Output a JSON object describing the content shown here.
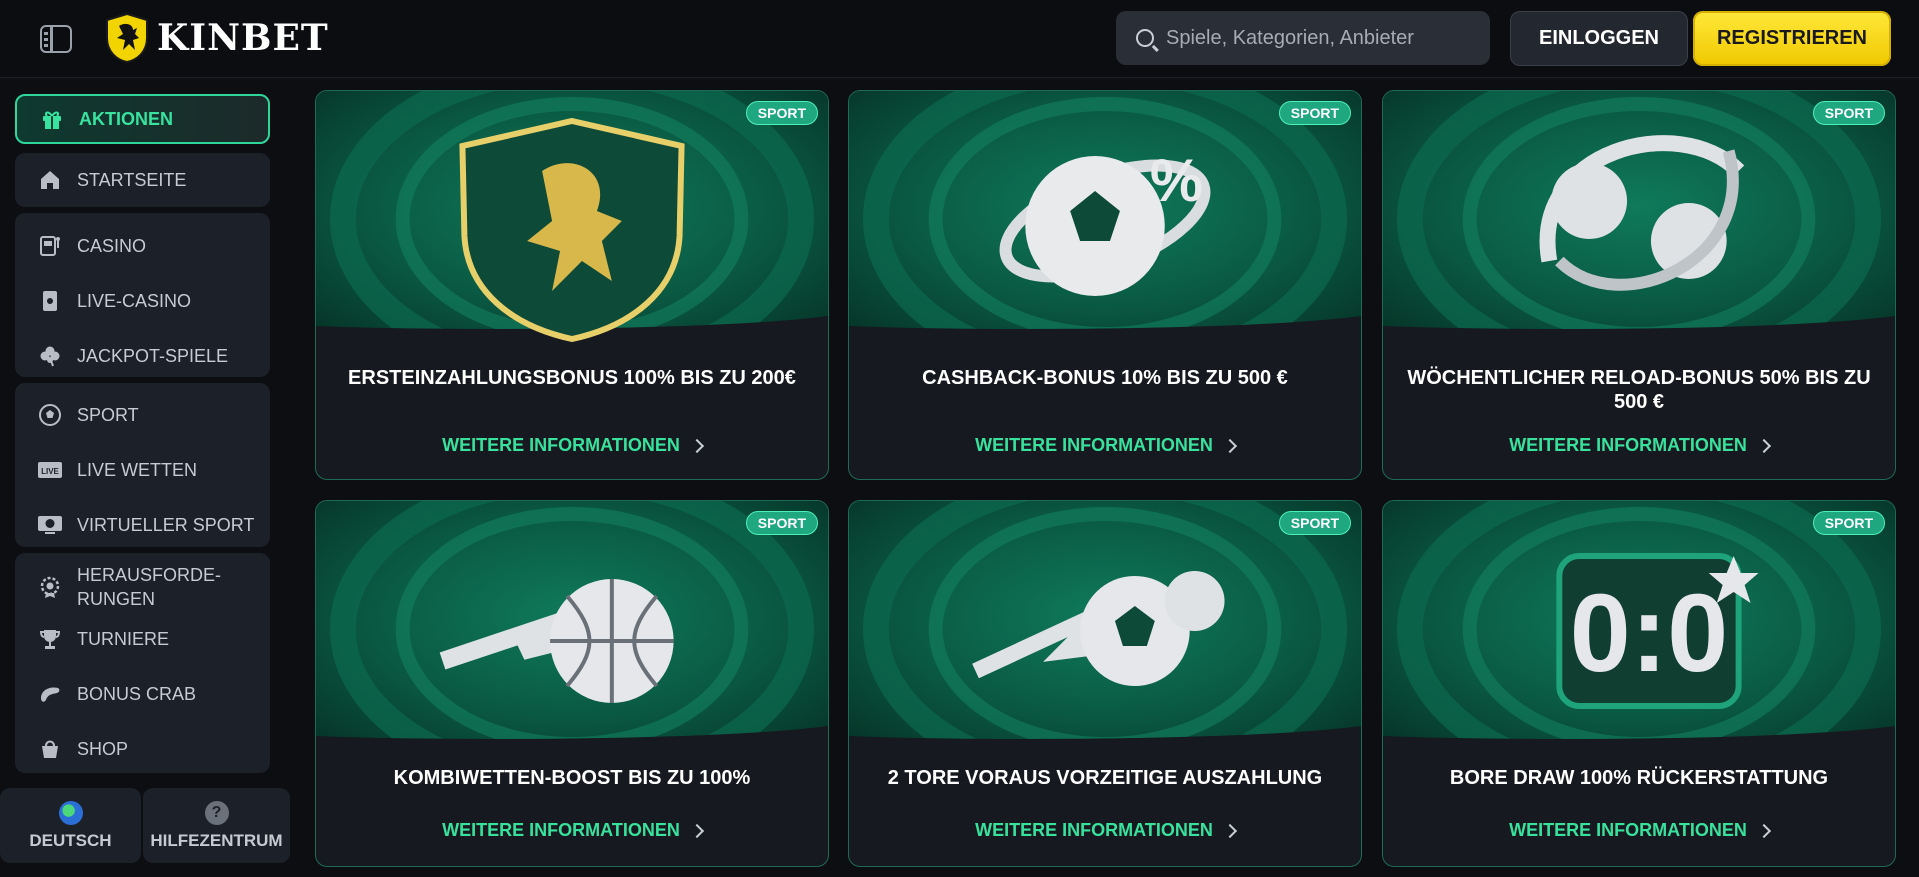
{
  "brand": {
    "name": "KINBET"
  },
  "header": {
    "search_placeholder": "Spiele, Kategorien, Anbieter",
    "login_label": "EINLOGGEN",
    "register_label": "REGISTRIEREN"
  },
  "sidebar": {
    "items": [
      {
        "label": "AKTIONEN",
        "icon": "gift-icon",
        "active": true
      },
      {
        "label": "STARTSEITE",
        "icon": "home-icon"
      },
      {
        "label": "CASINO",
        "icon": "slot-machine-icon"
      },
      {
        "label": "LIVE-CASINO",
        "icon": "card-icon"
      },
      {
        "label": "JACKPOT-SPIELE",
        "icon": "clover-icon"
      },
      {
        "label": "SPORT",
        "icon": "soccer-ball-icon"
      },
      {
        "label": "LIVE WETTEN",
        "icon": "live-icon"
      },
      {
        "label": "VIRTUELLER SPORT",
        "icon": "virtual-sport-icon"
      },
      {
        "label": "HERAUSFORDE-\nRUNGEN",
        "icon": "badge-icon"
      },
      {
        "label": "TURNIERE",
        "icon": "trophy-icon"
      },
      {
        "label": "BONUS CRAB",
        "icon": "crab-icon"
      },
      {
        "label": "SHOP",
        "icon": "shopping-bag-icon"
      }
    ],
    "footer": {
      "language_label": "DEUTSCH",
      "help_label": "HILFEZENTRUM"
    }
  },
  "promotions": [
    {
      "badge": "SPORT",
      "title": "ERSTEINZAHLUNGSBONUS 100% BIS ZU 200€",
      "link": "WEITERE INFORMATIONEN",
      "art": "lion-shield"
    },
    {
      "badge": "SPORT",
      "title": "CASHBACK-BONUS 10% BIS ZU 500 €",
      "link": "WEITERE INFORMATIONEN",
      "art": "ball-percent"
    },
    {
      "badge": "SPORT",
      "title": "WÖCHENTLICHER RELOAD-BONUS 50% BIS ZU 500 €",
      "link": "WEITERE INFORMATIONEN",
      "art": "tennis-balls"
    },
    {
      "badge": "SPORT",
      "title": "KOMBIWETTEN-BOOST BIS ZU 100%",
      "link": "WEITERE INFORMATIONEN",
      "art": "basketball"
    },
    {
      "badge": "SPORT",
      "title": "2 TORE VORAUS VORZEITIGE AUSZAHLUNG",
      "link": "WEITERE INFORMATIONEN",
      "art": "soccer-balls"
    },
    {
      "badge": "SPORT",
      "title": "BORE DRAW 100% RÜCKERSTATTUNG",
      "link": "WEITERE INFORMATIONEN",
      "art": "scoreboard"
    }
  ],
  "colors": {
    "accent": "#37e39e",
    "brand_yellow": "#ffe83a",
    "card_border": "#1f6a55"
  }
}
